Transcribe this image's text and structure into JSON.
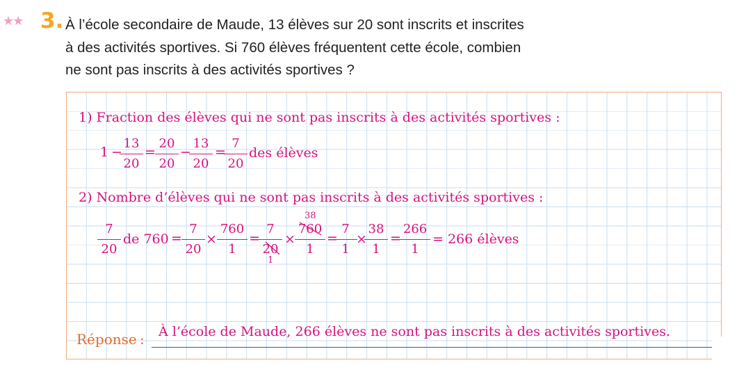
{
  "exercise": {
    "stars": "★★",
    "number": "3.",
    "question_lines": [
      "À l’école secondaire de Maude, 13 élèves sur 20 sont inscrits et inscrites",
      "à des activités sportives. Si 760 élèves fréquentent cette école, combien",
      "ne sont pas inscrits à des activités sportives ?"
    ]
  },
  "solution": {
    "step1": "1)  Fraction des élèves qui ne sont pas inscrits à des activités sportives :",
    "step1_expr": {
      "one": "1",
      "minus": "−",
      "eq": "=",
      "f1": {
        "n": "13",
        "d": "20"
      },
      "f2": {
        "n": "20",
        "d": "20"
      },
      "f3": {
        "n": "13",
        "d": "20"
      },
      "f4": {
        "n": "7",
        "d": "20"
      },
      "suffix": "des élèves"
    },
    "step2": "2)  Nombre d’élèves qui ne sont pas inscrits à des activités sportives :",
    "step2_expr": {
      "f1": {
        "n": "7",
        "d": "20"
      },
      "de": "de 760",
      "eq": "=",
      "times": "×",
      "f2": {
        "n": "7",
        "d": "20"
      },
      "f3": {
        "n": "760",
        "d": "1"
      },
      "f4": {
        "n": "7",
        "d": "20"
      },
      "f4_cancel": "1",
      "f5": {
        "n": "760",
        "d": "1"
      },
      "f5_cancel": "38",
      "f6": {
        "n": "7",
        "d": "1"
      },
      "f7": {
        "n": "38",
        "d": "1"
      },
      "f8": {
        "n": "266",
        "d": "1"
      },
      "result": "= 266 élèves"
    }
  },
  "answer": {
    "label": "Réponse",
    "colon": ":",
    "text": "À l’école de Maude, 266 élèves ne sont pas inscrits à des activités sportives."
  },
  "colors": {
    "accent_pink": "#d6127f",
    "number_orange": "#f5a623",
    "label_orange": "#e86b2a",
    "grid_blue": "#c9ddef",
    "border_orange": "#f5a97a"
  }
}
